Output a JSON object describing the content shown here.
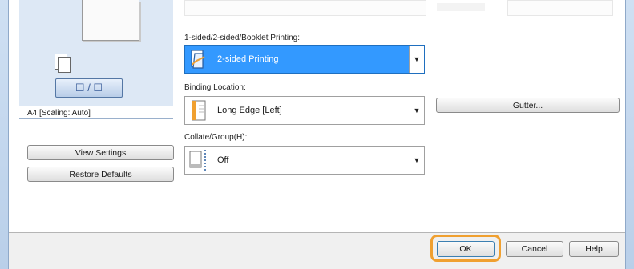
{
  "left_panel": {
    "preview_caption": "A4 [Scaling: Auto]",
    "duplex_glyph": "☐ / ☐",
    "view_settings_label": "View Settings",
    "restore_defaults_label": "Restore Defaults"
  },
  "print_options": {
    "sided_label": "1-sided/2-sided/Booklet Printing:",
    "sided_value": "2-sided Printing",
    "binding_label": "Binding Location:",
    "binding_value": "Long Edge [Left]",
    "collate_label": "Collate/Group(H):",
    "collate_value": "Off",
    "gutter_label": "Gutter..."
  },
  "dialog_buttons": {
    "ok": "OK",
    "cancel": "Cancel",
    "help": "Help"
  },
  "colors": {
    "selection": "#3399ff",
    "ok_highlight": "#f0a030"
  }
}
